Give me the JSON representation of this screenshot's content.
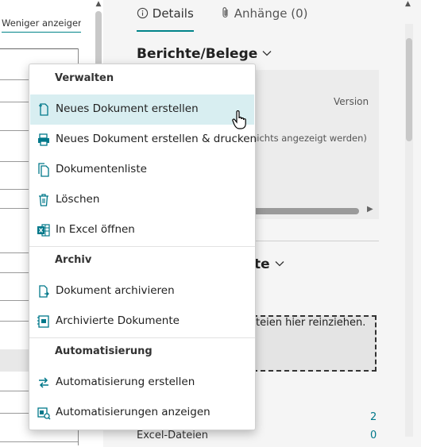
{
  "left": {
    "show_less": "Weniger anzeigen"
  },
  "tabs": {
    "details": "Details",
    "attachments": "Anhänge (0)"
  },
  "reports": {
    "title": "Berichte/Belege",
    "version": "Version",
    "hidden_note": "nichts angezeigt werden)"
  },
  "files": {
    "title": "te",
    "drop_text": "teien hier reinziehen.",
    "count_1": "2",
    "excel_label": "Excel-Dateien",
    "count_2": "0"
  },
  "menu": {
    "sections": [
      {
        "header": "Verwalten",
        "items": [
          {
            "label": "Neues Dokument erstellen",
            "icon": "new-document-icon"
          },
          {
            "label": "Neues Dokument erstellen & drucken",
            "icon": "new-document-print-icon"
          },
          {
            "label": "Dokumentenliste",
            "icon": "document-list-icon"
          },
          {
            "label": "Löschen",
            "icon": "trash-icon"
          },
          {
            "label": "In Excel öffnen",
            "icon": "excel-icon"
          }
        ]
      },
      {
        "header": "Archiv",
        "items": [
          {
            "label": "Dokument archivieren",
            "icon": "archive-document-icon"
          },
          {
            "label": "Archivierte Dokumente",
            "icon": "archived-documents-icon"
          }
        ]
      },
      {
        "header": "Automatisierung",
        "items": [
          {
            "label": "Automatisierung erstellen",
            "icon": "create-automation-icon"
          },
          {
            "label": "Automatisierungen anzeigen",
            "icon": "view-automations-icon"
          }
        ]
      }
    ]
  },
  "colors": {
    "accent": "#008489",
    "hover": "#d8eef1",
    "icon": "#00788a"
  }
}
